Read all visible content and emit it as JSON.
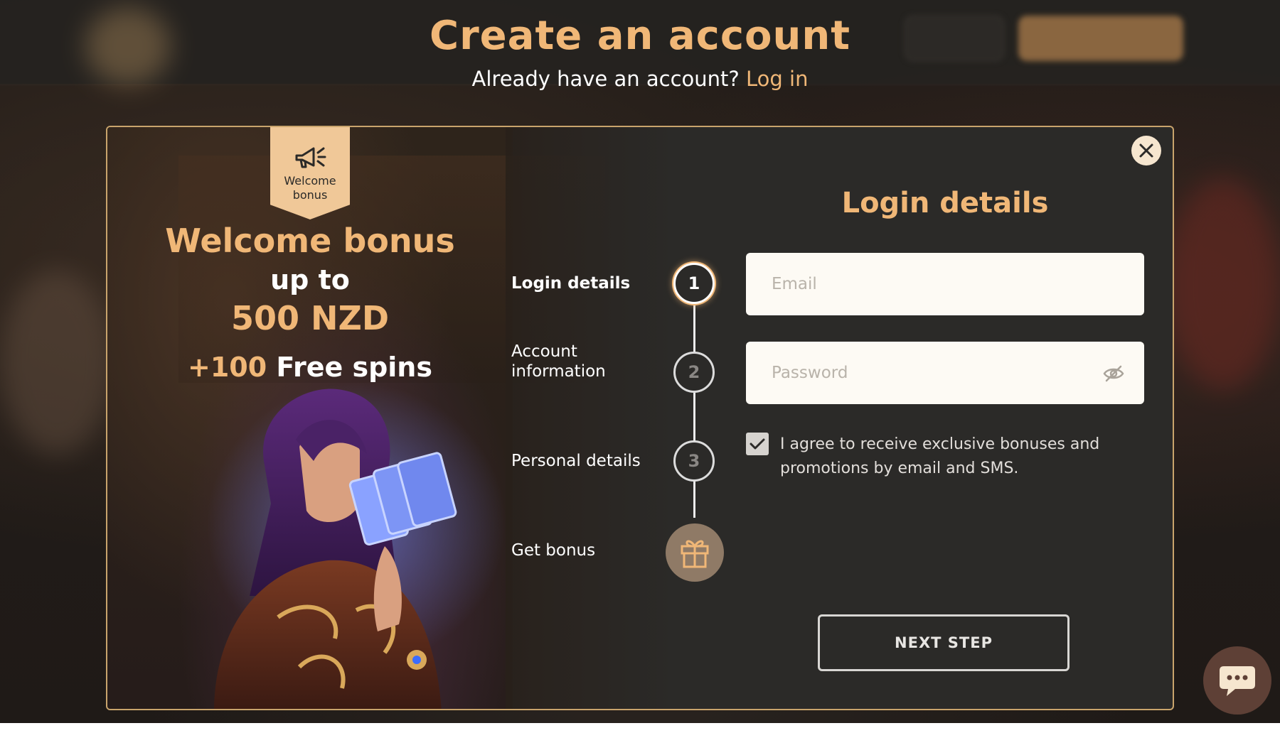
{
  "header": {
    "title": "Create an account",
    "subtitle_prefix": "Already have an account?",
    "login_link": "Log in"
  },
  "promo": {
    "badge_text": "Welcome bonus",
    "title": "Welcome bonus",
    "up_to": "up to",
    "amount": "500 NZD",
    "spins_number": "+100",
    "spins_text": "Free spins",
    "badge_icon": "megaphone-icon"
  },
  "steps": [
    {
      "label": "Login details",
      "number": "1",
      "state": "active"
    },
    {
      "label": "Account information",
      "number": "2",
      "state": "pending"
    },
    {
      "label": "Personal details",
      "number": "3",
      "state": "pending"
    },
    {
      "label": "Get bonus",
      "icon": "gift-icon",
      "state": "pending"
    }
  ],
  "form": {
    "title": "Login details",
    "email_placeholder": "Email",
    "password_placeholder": "Password",
    "agree_checked": true,
    "agree_text": "I agree to receive exclusive bonuses and promotions by email and SMS.",
    "next_label": "NEXT STEP"
  },
  "colors": {
    "accent": "#f0b777",
    "background": "#2b2a28",
    "modal_border": "#c9a46c"
  },
  "icons": [
    "close-icon",
    "eye-off-icon",
    "checkmark-icon",
    "chat-icon"
  ]
}
